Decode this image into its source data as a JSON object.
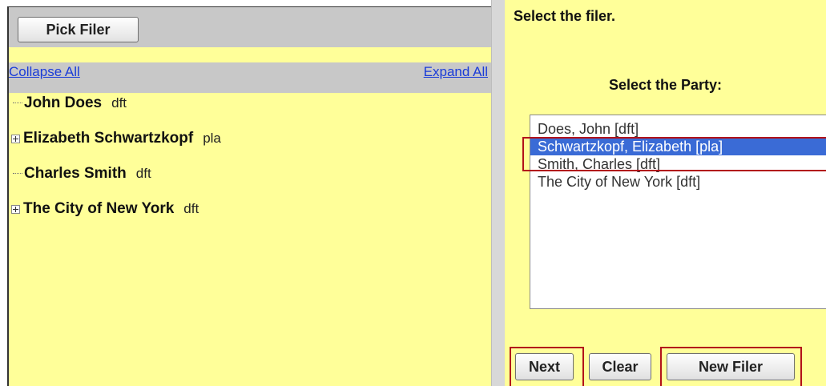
{
  "left_panel": {
    "pick_filer_label": "Pick Filer",
    "collapse_all": "Collapse All",
    "expand_all": "Expand All",
    "tree": [
      {
        "name": "John Does",
        "role": "dft",
        "expandable": false
      },
      {
        "name": "Elizabeth Schwartzkopf",
        "role": "pla",
        "expandable": true
      },
      {
        "name": "Charles Smith",
        "role": "dft",
        "expandable": false
      },
      {
        "name": "The City of New York",
        "role": "dft",
        "expandable": true
      }
    ]
  },
  "right_panel": {
    "instruction": "Select the filer.",
    "party_label": "Select the Party:",
    "parties": [
      {
        "label": "Does, John  [dft]",
        "selected": false
      },
      {
        "label": "Schwartzkopf, Elizabeth  [pla]",
        "selected": true
      },
      {
        "label": "Smith, Charles  [dft]",
        "selected": false
      },
      {
        "label": "The City of New York  [dft]",
        "selected": false
      }
    ],
    "buttons": {
      "next": "Next",
      "clear": "Clear",
      "new_filer": "New Filer"
    }
  },
  "colors": {
    "panel_background": "#ffff99",
    "header_gray": "#c8c8c8",
    "link_blue": "#1a3cd8",
    "selection_blue": "#3a6bd6",
    "highlight_red": "#b2121a"
  }
}
